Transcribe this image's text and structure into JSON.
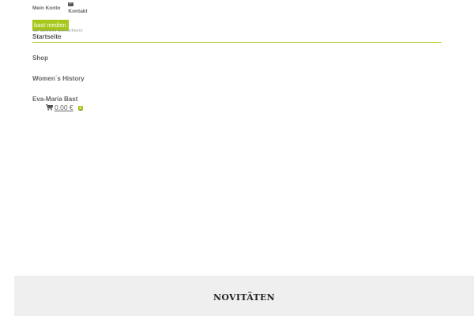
{
  "topbar": {
    "account_label": "Mein Konto",
    "contact_label": "Kontakt"
  },
  "logo": {
    "name": "bast medien",
    "tagline": "wir sammeln Geschichte(n)"
  },
  "nav": {
    "active_label": "Startseite",
    "items": [
      {
        "label": "Shop"
      },
      {
        "label": "Women´s History"
      },
      {
        "label": "Eva-Maria Bast"
      }
    ]
  },
  "cart": {
    "total": "0.00 €",
    "count": "0"
  },
  "news": {
    "heading": "NOVITÄTEN"
  },
  "colors": {
    "accent": "#a5c81a",
    "section_bg": "#efefef",
    "text": "#555555"
  },
  "icons": {
    "contact": "envelope-icon",
    "cart": "shopping-cart-icon"
  }
}
